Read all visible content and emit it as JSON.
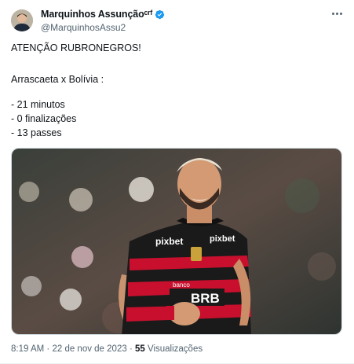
{
  "author": {
    "display_name": "Marquinhos Assunçãoᶜʳᶠ",
    "handle": "@MarquinhosAssu2",
    "verified_icon": "verified-badge-icon"
  },
  "tweet": {
    "lines": [
      "ATENÇÃO RUBRONEGROS!",
      "",
      "Arrascaeta x Bolívia :",
      "",
      "- 21 minutos",
      "- 0 finalizações",
      "- 13 passes"
    ],
    "media": {
      "shirt_sponsor_top": "pixbet",
      "shirt_sponsor_right": "pixbet",
      "shirt_sponsor_bank_small": "banco",
      "shirt_sponsor_bank": "BRB"
    }
  },
  "meta": {
    "time": "8:19 AM",
    "separator": "·",
    "date": "22 de nov de 2023",
    "views_count": "55",
    "views_label": "Visualizações"
  },
  "colors": {
    "accent_blue": "#1d9bf0",
    "text_primary": "#0f1419",
    "text_secondary": "#536471",
    "flamengo_red": "#c8102e"
  }
}
